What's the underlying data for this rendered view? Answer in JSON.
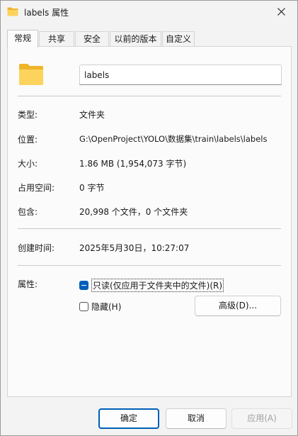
{
  "window": {
    "title": "labels 属性",
    "close_label": "×"
  },
  "tabs": [
    {
      "label": "常规",
      "active": true
    },
    {
      "label": "共享",
      "active": false
    },
    {
      "label": "安全",
      "active": false
    },
    {
      "label": "以前的版本",
      "active": false
    },
    {
      "label": "自定义",
      "active": false
    }
  ],
  "general": {
    "name_value": "labels",
    "type_label": "类型:",
    "type_value": "文件夹",
    "location_label": "位置:",
    "location_value": "G:\\OpenProject\\YOLO\\数据集\\train\\labels\\labels",
    "size_label": "大小:",
    "size_value": "1.86 MB (1,954,073 字节)",
    "disk_size_label": "占用空间:",
    "disk_size_value": "0 字节",
    "contains_label": "包含:",
    "contains_value": "20,998 个文件，0 个文件夹",
    "created_label": "创建时间:",
    "created_value": "2025年5月30日，10:27:07",
    "attributes_label": "属性:",
    "readonly_label": "只读(仅应用于文件夹中的文件)(R)",
    "readonly_state": "indeterminate",
    "hidden_label": "隐藏(H)",
    "hidden_state": "unchecked",
    "advanced_label": "高级(D)..."
  },
  "footer": {
    "ok_label": "确定",
    "cancel_label": "取消",
    "apply_label": "应用(A)"
  },
  "colors": {
    "accent": "#005fb8",
    "folder_front": "#fcd35c",
    "folder_back": "#f0b429"
  }
}
